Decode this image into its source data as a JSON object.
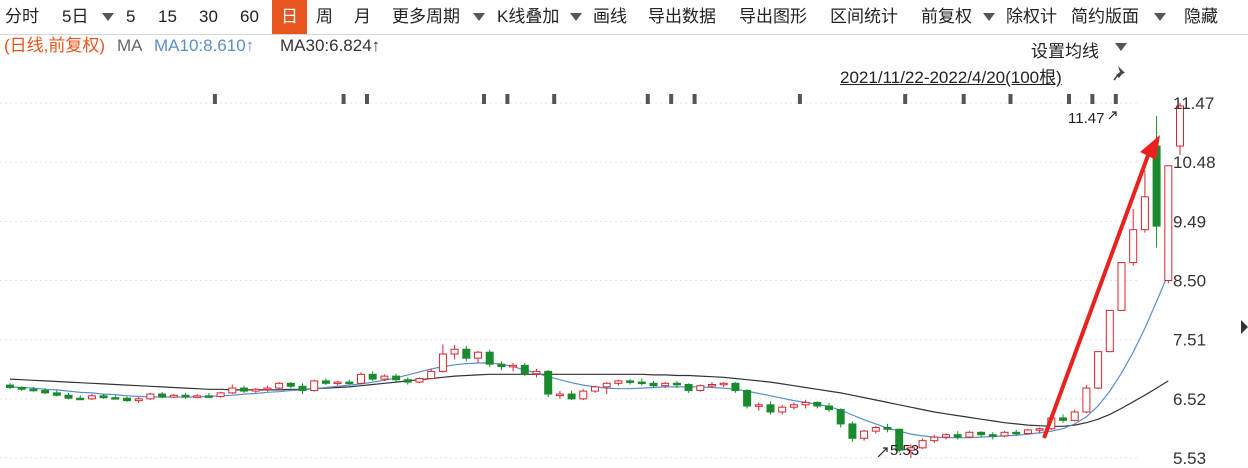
{
  "toolbar": {
    "items": [
      {
        "label": "分时"
      },
      {
        "label": "5日"
      },
      {
        "label": "5"
      },
      {
        "label": "15"
      },
      {
        "label": "30"
      },
      {
        "label": "60"
      },
      {
        "label": "日",
        "active": true
      },
      {
        "label": "周"
      },
      {
        "label": "月"
      },
      {
        "label": "更多周期"
      },
      {
        "label": "K线叠加"
      },
      {
        "label": "画线"
      },
      {
        "label": "导出数据"
      },
      {
        "label": "导出图形"
      },
      {
        "label": "区间统计"
      },
      {
        "label": "前复权"
      },
      {
        "label": "除权计"
      },
      {
        "label": "简约版面"
      },
      {
        "label": "隐藏"
      }
    ]
  },
  "info": {
    "mode": "(日线,前复权)",
    "ma_label": "MA",
    "ma10": "MA10:8.610↑",
    "ma30": "MA30:6.824↑"
  },
  "ma_settings": "设置均线",
  "date_range": "2021/11/22-2022/4/20(100根)",
  "colors": {
    "up": "#d8262f",
    "down": "#1a8a2e",
    "ma10": "#5b8fc9",
    "ma30": "#333333",
    "active_tab": "#e8551e",
    "arrow": "#e8231d"
  },
  "chart_data": {
    "type": "candlestick",
    "title": "",
    "xlabel": "",
    "ylabel": "",
    "ylim": [
      5.53,
      11.47
    ],
    "y_ticks": [
      "11.47",
      "10.48",
      "9.49",
      "8.50",
      "7.51",
      "6.52",
      "5.53"
    ],
    "max_label": "11.47",
    "min_label": "5.53",
    "candles": [
      [
        6.75,
        6.78,
        6.68,
        6.71
      ],
      [
        6.71,
        6.73,
        6.65,
        6.68
      ],
      [
        6.68,
        6.72,
        6.64,
        6.66
      ],
      [
        6.66,
        6.7,
        6.6,
        6.62
      ],
      [
        6.62,
        6.66,
        6.56,
        6.58
      ],
      [
        6.58,
        6.62,
        6.51,
        6.53
      ],
      [
        6.53,
        6.58,
        6.5,
        6.52
      ],
      [
        6.52,
        6.6,
        6.5,
        6.57
      ],
      [
        6.57,
        6.6,
        6.52,
        6.54
      ],
      [
        6.54,
        6.58,
        6.51,
        6.53
      ],
      [
        6.53,
        6.56,
        6.47,
        6.49
      ],
      [
        6.49,
        6.55,
        6.45,
        6.52
      ],
      [
        6.52,
        6.62,
        6.5,
        6.6
      ],
      [
        6.6,
        6.63,
        6.53,
        6.55
      ],
      [
        6.55,
        6.6,
        6.53,
        6.58
      ],
      [
        6.58,
        6.62,
        6.52,
        6.55
      ],
      [
        6.55,
        6.6,
        6.53,
        6.57
      ],
      [
        6.57,
        6.62,
        6.54,
        6.56
      ],
      [
        6.56,
        6.64,
        6.54,
        6.62
      ],
      [
        6.62,
        6.76,
        6.6,
        6.7
      ],
      [
        6.7,
        6.74,
        6.62,
        6.65
      ],
      [
        6.65,
        6.7,
        6.62,
        6.68
      ],
      [
        6.68,
        6.74,
        6.64,
        6.7
      ],
      [
        6.7,
        6.8,
        6.68,
        6.78
      ],
      [
        6.78,
        6.8,
        6.7,
        6.73
      ],
      [
        6.73,
        6.78,
        6.6,
        6.66
      ],
      [
        6.66,
        6.84,
        6.64,
        6.82
      ],
      [
        6.82,
        6.86,
        6.75,
        6.78
      ],
      [
        6.78,
        6.82,
        6.74,
        6.8
      ],
      [
        6.8,
        6.84,
        6.76,
        6.78
      ],
      [
        6.78,
        6.96,
        6.76,
        6.93
      ],
      [
        6.93,
        6.98,
        6.82,
        6.85
      ],
      [
        6.85,
        6.93,
        6.82,
        6.9
      ],
      [
        6.9,
        6.94,
        6.8,
        6.84
      ],
      [
        6.84,
        6.88,
        6.76,
        6.8
      ],
      [
        6.8,
        6.88,
        6.78,
        6.86
      ],
      [
        6.86,
        7.02,
        6.85,
        6.98
      ],
      [
        6.98,
        7.43,
        6.96,
        7.27
      ],
      [
        7.27,
        7.42,
        7.18,
        7.35
      ],
      [
        7.35,
        7.4,
        7.15,
        7.2
      ],
      [
        7.2,
        7.32,
        7.12,
        7.3
      ],
      [
        7.3,
        7.34,
        7.05,
        7.1
      ],
      [
        7.1,
        7.15,
        7.0,
        7.06
      ],
      [
        7.06,
        7.12,
        6.98,
        7.08
      ],
      [
        7.08,
        7.12,
        6.9,
        6.94
      ],
      [
        6.94,
        7.02,
        6.88,
        6.98
      ],
      [
        6.98,
        7.0,
        6.55,
        6.6
      ],
      [
        6.6,
        6.65,
        6.52,
        6.6
      ],
      [
        6.6,
        6.66,
        6.5,
        6.52
      ],
      [
        6.52,
        6.68,
        6.5,
        6.65
      ],
      [
        6.65,
        6.74,
        6.62,
        6.72
      ],
      [
        6.72,
        6.8,
        6.6,
        6.78
      ],
      [
        6.78,
        6.84,
        6.74,
        6.82
      ],
      [
        6.82,
        6.85,
        6.76,
        6.8
      ],
      [
        6.8,
        6.86,
        6.74,
        6.78
      ],
      [
        6.78,
        6.82,
        6.7,
        6.74
      ],
      [
        6.74,
        6.8,
        6.7,
        6.78
      ],
      [
        6.78,
        6.82,
        6.7,
        6.76
      ],
      [
        6.76,
        6.78,
        6.62,
        6.66
      ],
      [
        6.66,
        6.76,
        6.64,
        6.74
      ],
      [
        6.74,
        6.8,
        6.7,
        6.76
      ],
      [
        6.76,
        6.8,
        6.72,
        6.78
      ],
      [
        6.78,
        6.8,
        6.62,
        6.66
      ],
      [
        6.66,
        6.68,
        6.36,
        6.4
      ],
      [
        6.4,
        6.46,
        6.32,
        6.42
      ],
      [
        6.42,
        6.48,
        6.26,
        6.3
      ],
      [
        6.3,
        6.42,
        6.26,
        6.38
      ],
      [
        6.38,
        6.46,
        6.34,
        6.42
      ],
      [
        6.42,
        6.5,
        6.36,
        6.46
      ],
      [
        6.46,
        6.48,
        6.36,
        6.4
      ],
      [
        6.4,
        6.45,
        6.3,
        6.34
      ],
      [
        6.34,
        6.36,
        6.04,
        6.1
      ],
      [
        6.1,
        6.14,
        5.8,
        5.86
      ],
      [
        5.86,
        6.0,
        5.82,
        5.98
      ],
      [
        5.98,
        6.07,
        5.94,
        6.04
      ],
      [
        6.04,
        6.1,
        5.96,
        6.01
      ],
      [
        6.01,
        6.02,
        5.62,
        5.66
      ],
      [
        5.66,
        5.76,
        5.53,
        5.7
      ],
      [
        5.7,
        5.86,
        5.68,
        5.82
      ],
      [
        5.82,
        5.92,
        5.78,
        5.88
      ],
      [
        5.88,
        5.94,
        5.84,
        5.92
      ],
      [
        5.92,
        5.98,
        5.84,
        5.88
      ],
      [
        5.88,
        5.98,
        5.86,
        5.96
      ],
      [
        5.96,
        5.98,
        5.88,
        5.92
      ],
      [
        5.92,
        5.96,
        5.84,
        5.9
      ],
      [
        5.9,
        5.98,
        5.88,
        5.96
      ],
      [
        5.96,
        6.0,
        5.9,
        5.94
      ],
      [
        5.94,
        6.02,
        5.92,
        6.0
      ],
      [
        6.0,
        6.04,
        5.94,
        6.02
      ],
      [
        6.02,
        6.28,
        6.0,
        6.2
      ],
      [
        6.2,
        6.26,
        6.12,
        6.16
      ],
      [
        6.16,
        6.34,
        6.14,
        6.3
      ],
      [
        6.3,
        6.75,
        6.28,
        6.7
      ],
      [
        6.7,
        7.31,
        6.68,
        7.31
      ],
      [
        7.31,
        7.81,
        7.3,
        8.0
      ],
      [
        8.0,
        8.8,
        8.0,
        8.8
      ],
      [
        8.8,
        9.7,
        8.75,
        9.35
      ],
      [
        9.35,
        10.34,
        9.3,
        9.9
      ],
      [
        10.75,
        11.25,
        9.05,
        9.41
      ],
      [
        8.5,
        10.42,
        8.45,
        10.42
      ],
      [
        10.75,
        11.47,
        10.6,
        11.42
      ]
    ],
    "ma10": [
      6.72,
      6.71,
      6.7,
      6.68,
      6.67,
      6.65,
      6.63,
      6.62,
      6.6,
      6.59,
      6.57,
      6.56,
      6.55,
      6.55,
      6.55,
      6.55,
      6.55,
      6.56,
      6.57,
      6.58,
      6.6,
      6.61,
      6.63,
      6.64,
      6.66,
      6.67,
      6.69,
      6.71,
      6.73,
      6.75,
      6.77,
      6.8,
      6.83,
      6.87,
      6.92,
      6.97,
      7.02,
      7.06,
      7.09,
      7.11,
      7.12,
      7.12,
      7.1,
      7.06,
      7.0,
      6.95,
      6.89,
      6.84,
      6.79,
      6.75,
      6.72,
      6.7,
      6.69,
      6.69,
      6.7,
      6.71,
      6.72,
      6.72,
      6.72,
      6.72,
      6.71,
      6.7,
      6.68,
      6.65,
      6.61,
      6.57,
      6.53,
      6.49,
      6.46,
      6.43,
      6.39,
      6.33,
      6.25,
      6.17,
      6.1,
      6.03,
      5.98,
      5.93,
      5.9,
      5.88,
      5.87,
      5.87,
      5.87,
      5.88,
      5.89,
      5.9,
      5.91,
      5.93,
      5.95,
      5.98,
      6.02,
      6.1,
      6.22,
      6.4,
      6.65,
      6.95,
      7.3,
      7.7,
      8.15,
      8.61
    ],
    "ma30": [
      6.85,
      6.84,
      6.83,
      6.82,
      6.81,
      6.8,
      6.79,
      6.78,
      6.77,
      6.76,
      6.75,
      6.74,
      6.73,
      6.72,
      6.71,
      6.7,
      6.69,
      6.68,
      6.68,
      6.67,
      6.67,
      6.67,
      6.67,
      6.67,
      6.68,
      6.68,
      6.69,
      6.7,
      6.71,
      6.72,
      6.74,
      6.76,
      6.78,
      6.8,
      6.82,
      6.84,
      6.86,
      6.88,
      6.9,
      6.91,
      6.92,
      6.93,
      6.93,
      6.93,
      6.93,
      6.93,
      6.93,
      6.93,
      6.93,
      6.93,
      6.93,
      6.93,
      6.93,
      6.93,
      6.93,
      6.92,
      6.92,
      6.91,
      6.91,
      6.9,
      6.89,
      6.88,
      6.86,
      6.84,
      6.82,
      6.8,
      6.77,
      6.74,
      6.71,
      6.68,
      6.65,
      6.62,
      6.58,
      6.54,
      6.5,
      6.46,
      6.42,
      6.38,
      6.34,
      6.3,
      6.27,
      6.24,
      6.21,
      6.18,
      6.15,
      6.12,
      6.1,
      6.08,
      6.07,
      6.06,
      6.06,
      6.08,
      6.12,
      6.18,
      6.26,
      6.36,
      6.47,
      6.58,
      6.7,
      6.82
    ]
  }
}
